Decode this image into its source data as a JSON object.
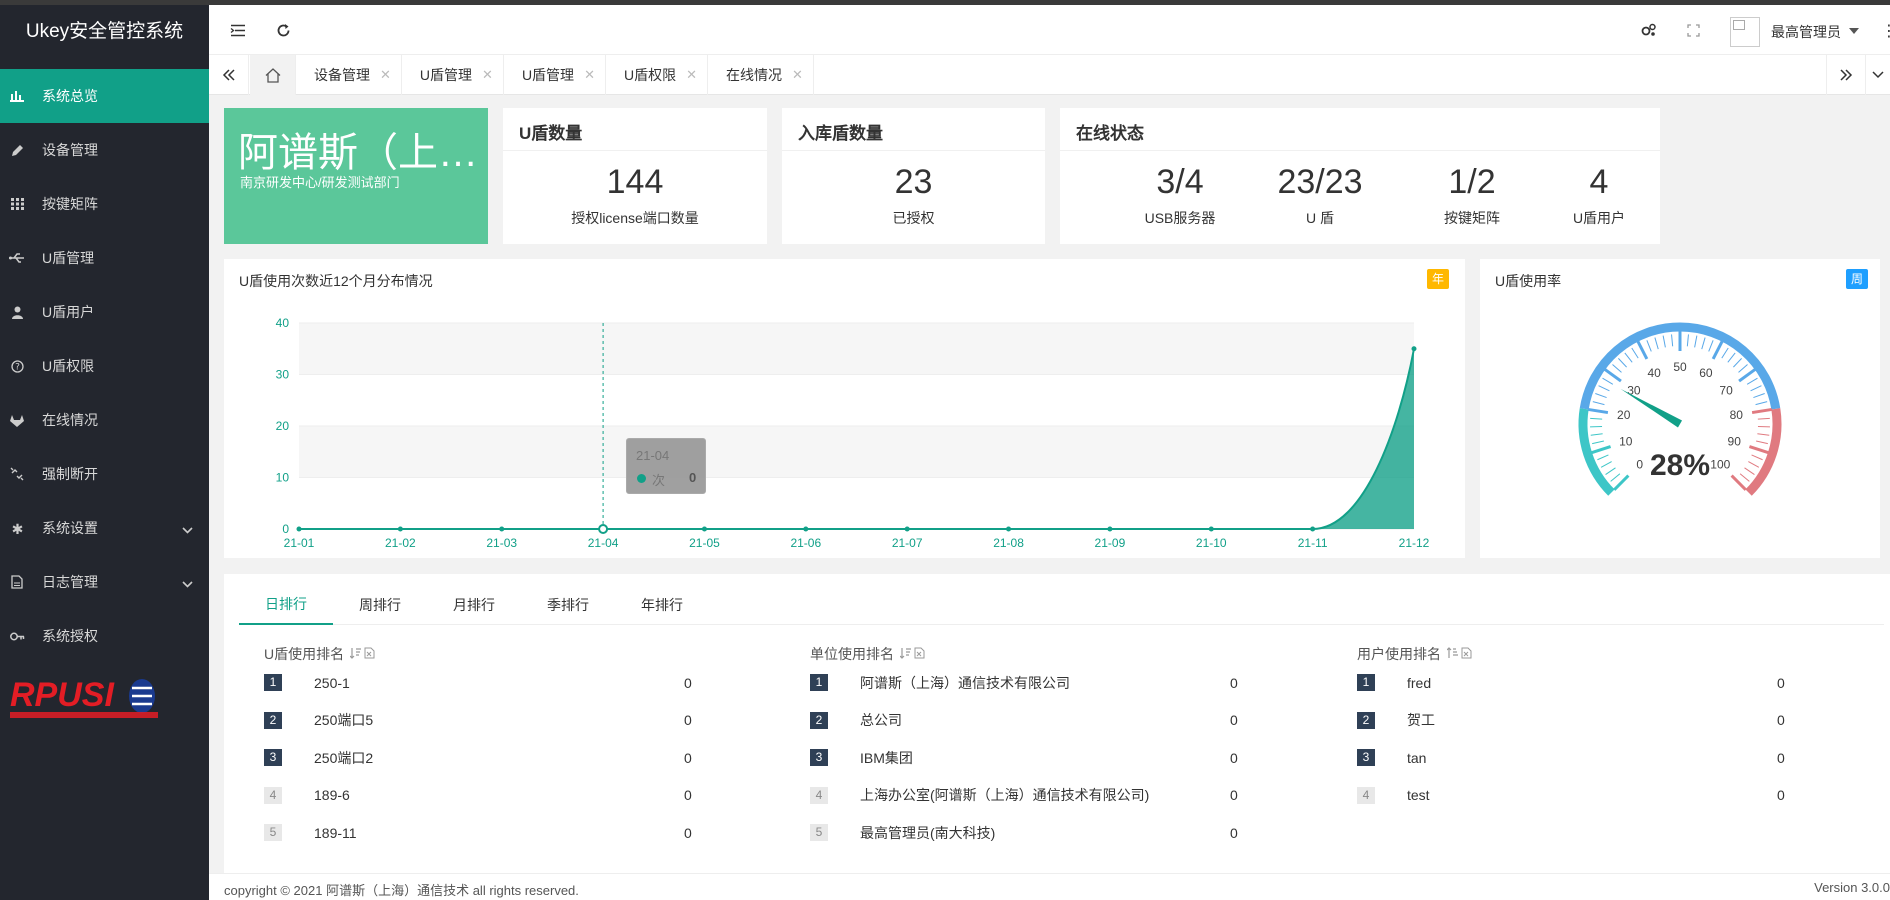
{
  "app": {
    "title": "Ukey安全管控系统"
  },
  "sidebar": {
    "items": [
      {
        "label": "系统总览",
        "icon": "bar-chart-icon"
      },
      {
        "label": "设备管理",
        "icon": "pencil-icon"
      },
      {
        "label": "按键矩阵",
        "icon": "grid-icon"
      },
      {
        "label": "U盾管理",
        "icon": "usb-icon"
      },
      {
        "label": "U盾用户",
        "icon": "user-icon"
      },
      {
        "label": "U盾权限",
        "icon": "question-circle-icon"
      },
      {
        "label": "在线情况",
        "icon": "gitlab-icon"
      },
      {
        "label": "强制断开",
        "icon": "unlink-icon"
      },
      {
        "label": "系统设置",
        "icon": "gear-icon"
      },
      {
        "label": "日志管理",
        "icon": "file-icon"
      },
      {
        "label": "系统授权",
        "icon": "key-icon"
      }
    ],
    "brand": "RPUSI"
  },
  "header": {
    "user": "最高管理员"
  },
  "tabs": [
    {
      "label": "设备管理"
    },
    {
      "label": "U盾管理"
    },
    {
      "label": "U盾管理"
    },
    {
      "label": "U盾权限"
    },
    {
      "label": "在线情况"
    }
  ],
  "company": {
    "name": "阿谱斯（上…",
    "dept": "南京研发中心/研发测试部门"
  },
  "ukey_count": {
    "title": "U盾数量",
    "value": "144",
    "label": "授权license端口数量"
  },
  "stored_count": {
    "title": "入库盾数量",
    "value": "23",
    "label": "已授权"
  },
  "online": {
    "title": "在线状态",
    "stats": [
      {
        "value": "3/4",
        "label": "USB服务器"
      },
      {
        "value": "23/23",
        "label": "U 盾"
      },
      {
        "value": "1/2",
        "label": "按键矩阵"
      },
      {
        "value": "4",
        "label": "U盾用户"
      }
    ]
  },
  "usage_chart": {
    "title": "U盾使用次数近12个月分布情况",
    "badge": "年",
    "tooltip": {
      "title": "21-04",
      "series": "次",
      "value": "0"
    }
  },
  "chart_data": {
    "type": "area",
    "categories": [
      "21-01",
      "21-02",
      "21-03",
      "21-04",
      "21-05",
      "21-06",
      "21-07",
      "21-08",
      "21-09",
      "21-10",
      "21-11",
      "21-12"
    ],
    "series": [
      {
        "name": "次",
        "values": [
          0,
          0,
          0,
          0,
          0,
          0,
          0,
          0,
          0,
          0,
          0,
          35
        ]
      }
    ],
    "y_ticks": [
      0,
      10,
      20,
      30,
      40
    ],
    "ylim": [
      0,
      40
    ],
    "color": "#11a088"
  },
  "rate_gauge": {
    "title": "U盾使用率",
    "badge": "周",
    "value": 28,
    "display": "28%",
    "ticks": [
      "0",
      "10",
      "20",
      "30",
      "40",
      "50",
      "60",
      "70",
      "80",
      "90",
      "100"
    ]
  },
  "ranking": {
    "tabs": [
      "日排行",
      "周排行",
      "月排行",
      "季排行",
      "年排行"
    ],
    "columns": [
      {
        "title": "U盾使用排名",
        "rows": [
          {
            "rank": "1",
            "name": "250-1",
            "value": "0"
          },
          {
            "rank": "2",
            "name": "250端口5",
            "value": "0"
          },
          {
            "rank": "3",
            "name": "250端口2",
            "value": "0"
          },
          {
            "rank": "4",
            "name": "189-6",
            "value": "0"
          },
          {
            "rank": "5",
            "name": "189-11",
            "value": "0"
          }
        ]
      },
      {
        "title": "单位使用排名",
        "rows": [
          {
            "rank": "1",
            "name": "阿谱斯（上海）通信技术有限公司",
            "value": "0"
          },
          {
            "rank": "2",
            "name": "总公司",
            "value": "0"
          },
          {
            "rank": "3",
            "name": "IBM集团",
            "value": "0"
          },
          {
            "rank": "4",
            "name": "上海办公室(阿谱斯（上海）通信技术有限公司)",
            "value": "0"
          },
          {
            "rank": "5",
            "name": "最高管理员(南大科技)",
            "value": "0"
          }
        ]
      },
      {
        "title": "用户使用排名",
        "rows": [
          {
            "rank": "1",
            "name": "fred",
            "value": "0"
          },
          {
            "rank": "2",
            "name": "贺工",
            "value": "0"
          },
          {
            "rank": "3",
            "name": "tan",
            "value": "0"
          },
          {
            "rank": "4",
            "name": "test",
            "value": "0"
          }
        ]
      }
    ]
  },
  "footer": {
    "copyright": "copyright © 2021 阿谱斯（上海）通信技术 all rights reserved.",
    "version": "Version 3.0.0"
  }
}
